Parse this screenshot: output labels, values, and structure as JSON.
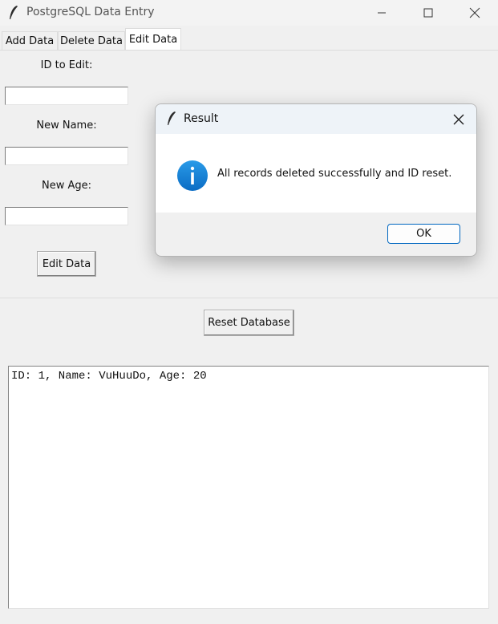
{
  "window": {
    "title": "PostgreSQL Data Entry"
  },
  "tabs": [
    {
      "label": "Add Data"
    },
    {
      "label": "Delete Data"
    },
    {
      "label": "Edit Data"
    }
  ],
  "form": {
    "id_label": "ID to Edit:",
    "id_value": "",
    "name_label": "New Name:",
    "name_value": "",
    "age_label": "New Age:",
    "age_value": "",
    "edit_button": "Edit Data"
  },
  "reset_button": "Reset Database",
  "output_text": "ID: 1, Name: VuHuuDo, Age: 20",
  "dialog": {
    "title": "Result",
    "message": "All records deleted successfully and ID reset.",
    "ok_button": "OK",
    "icon": "info-icon"
  },
  "colors": {
    "info_blue": "#0a78d4",
    "ok_border": "#0067c0"
  }
}
